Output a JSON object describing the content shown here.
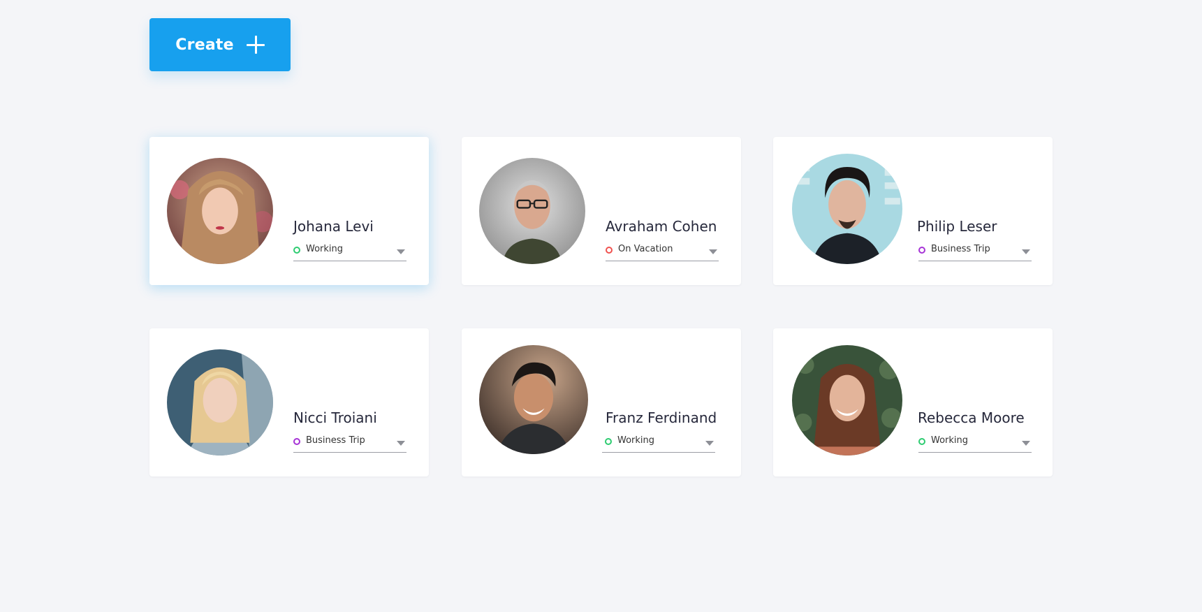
{
  "toolbar": {
    "create_label": "Create",
    "create_icon": "plus-icon",
    "create_color": "#17a0ee"
  },
  "status_colors": {
    "Working": "#2ecc71",
    "On Vacation": "#f0524f",
    "Business Trip": "#a633d6"
  },
  "people": [
    {
      "name": "Johana Levi",
      "status": "Working"
    },
    {
      "name": "Avraham Cohen",
      "status": "On Vacation"
    },
    {
      "name": "Philip Leser",
      "status": "Business Trip"
    },
    {
      "name": "Nicci Troiani",
      "status": "Business Trip"
    },
    {
      "name": "Franz Ferdinand",
      "status": "Working"
    },
    {
      "name": "Rebecca Moore",
      "status": "Working"
    }
  ]
}
